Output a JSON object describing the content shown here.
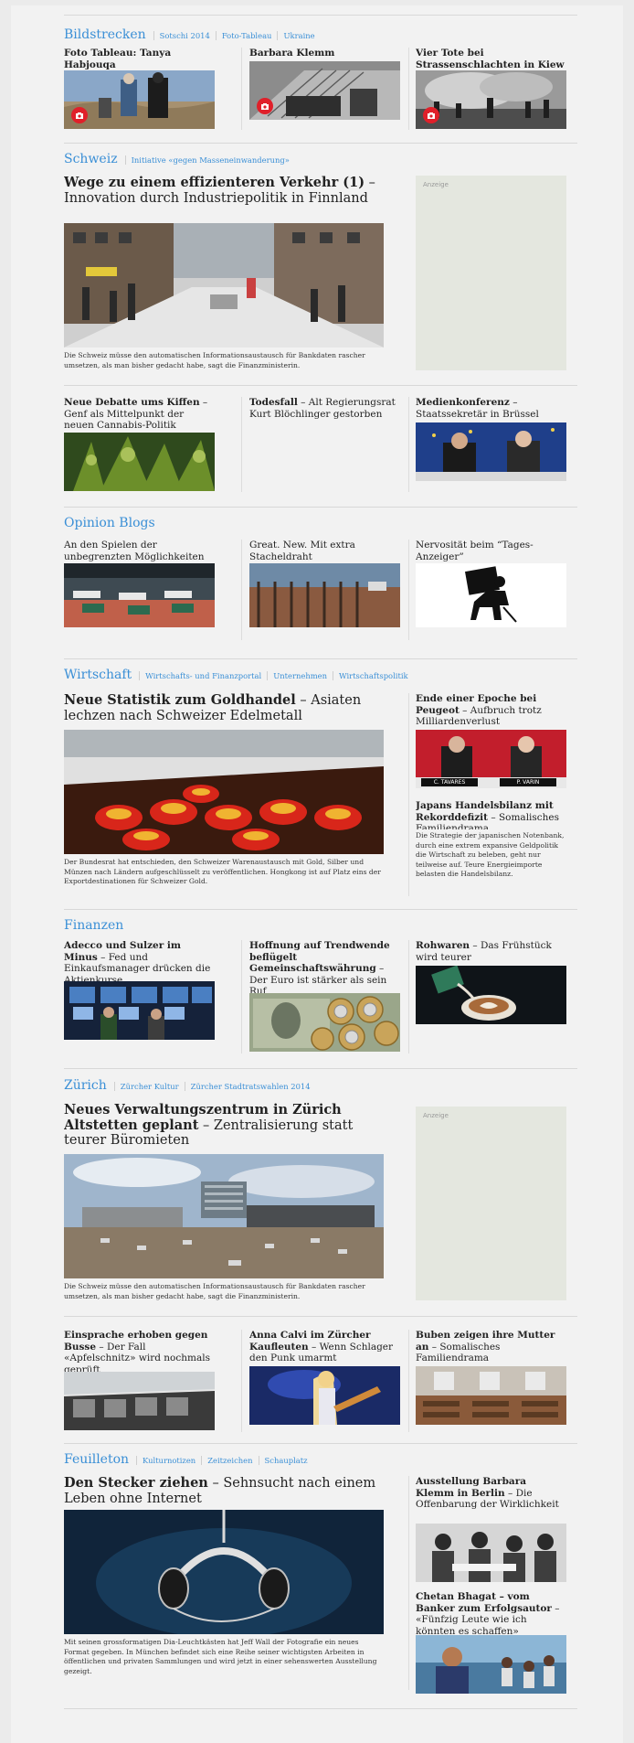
{
  "bildstrecken": {
    "title": "Bildstrecken",
    "links": [
      "Sotschi 2014",
      "Foto-Tableau",
      "Ukraine"
    ],
    "items": [
      "Foto Tableau: Tanya Habjouqa",
      "Barbara Klemm",
      "Vier Tote bei Strassenschlachten in Kiew"
    ]
  },
  "schweiz": {
    "title": "Schweiz",
    "links": [
      "Initiative «gegen Masseneinwanderung»"
    ],
    "main": {
      "head": "Wege zu einem effizienteren Verkehr (1)",
      "sub": " – Innovation durch Industriepolitik in Finnland",
      "lead": "Die Schweiz müsse den automatischen Informationsaustausch für Bankdaten rascher umsetzen, als man bisher gedacht habe, sagt die Finanzministerin."
    },
    "ad_label": "Anzeige",
    "teasers": [
      {
        "head": "Neue Debatte ums Kiffen",
        "sub": " – Genf als Mittelpunkt der neuen Cannabis-Politik"
      },
      {
        "head": "Todesfall",
        "sub": " – Alt Regierungsrat Kurt Blöchlinger gestorben"
      },
      {
        "head": "Medienkonferenz",
        "sub": " – Staatssekretär in Brüssel"
      }
    ]
  },
  "opinion": {
    "title": "Opinion Blogs",
    "items": [
      "An den Spielen der unbegrenzten Möglichkeiten",
      "Great. New. Mit extra Stacheldraht",
      "Nervosität beim “Tages-Anzeiger”"
    ]
  },
  "wirtschaft": {
    "title": "Wirtschaft",
    "links": [
      "Wirtschafts- und Finanzportal",
      "Unternehmen",
      "Wirtschaftspolitik"
    ],
    "main": {
      "head": "Neue Statistik zum Goldhandel",
      "sub": " – Asiaten lechzen nach Schweizer Edelmetall",
      "lead": "Der Bundesrat hat entschieden, den Schweizer Warenaustausch mit Gold, Silber und Münzen nach Ländern aufgeschlüsselt zu veröffentlichen. Hongkong ist auf Platz eins der Exportdestinationen für Schweizer Gold."
    },
    "side": [
      {
        "head": "Ende einer Epoche bei Peugeot",
        "sub": " – Aufbruch trotz Milliardenverlust",
        "labels": [
          "C. TAVARES",
          "P. VARIN"
        ]
      },
      {
        "head": "Japans Handelsbilanz mit Rekorddefizit",
        "sub": " – Somalisches Familiendrama",
        "lead": "Die Strategie der japanischen Notenbank, durch eine extrem expansive Geldpolitik die Wirtschaft zu beleben, geht nur teilweise auf. Teure Energieimporte belasten die Handelsbilanz."
      }
    ]
  },
  "finanzen": {
    "title": "Finanzen",
    "items": [
      {
        "head": "Adecco und Sulzer im Minus",
        "sub": " – Fed und Einkaufsmanager drücken die Aktienkurse"
      },
      {
        "head": "Hoffnung auf Trendwende beflügelt Gemeinschaftswährung",
        "sub": " – Der Euro ist stärker als sein Ruf"
      },
      {
        "head": "Rohwaren",
        "sub": " – Das Frühstück wird teurer"
      }
    ]
  },
  "zuerich": {
    "title": "Zürich",
    "links": [
      "Zürcher Kultur",
      "Zürcher Stadtratswahlen 2014"
    ],
    "main": {
      "head": "Neues Verwaltungszentrum in Zürich Altstetten geplant",
      "sub": " – Zentralisierung statt teurer Büromieten",
      "lead": "Die Schweiz müsse den automatischen Informationsaustausch für Bankdaten rascher umsetzen, als man bisher gedacht habe, sagt die Finanzministerin."
    },
    "ad_label": "Anzeige",
    "teasers": [
      {
        "head": "Einsprache erhoben gegen Busse",
        "sub": " – Der Fall «Apfelschnitz» wird nochmals geprüft"
      },
      {
        "head": "Anna Calvi im Zürcher Kaufleuten",
        "sub": " – Wenn Schlager den Punk umarmt"
      },
      {
        "head": "Buben zeigen ihre Mutter an",
        "sub": " – Somalisches Familiendrama"
      }
    ]
  },
  "feuilleton": {
    "title": "Feuilleton",
    "links": [
      "Kulturnotizen",
      "Zeitzeichen",
      "Schauplatz"
    ],
    "main": {
      "head": "Den Stecker ziehen",
      "sub": " – Sehnsucht nach einem Leben ohne Internet",
      "lead": "Mit seinen grossformatigen Dia-Leuchtkästen hat Jeff Wall der Fotografie ein neues Format gegeben. In München befindet sich eine Reihe seiner wichtigsten Arbeiten in öffentlichen und privaten Sammlungen und wird jetzt in einer sehenswerten Ausstellung gezeigt."
    },
    "side": [
      {
        "head": "Ausstellung Barbara Klemm in Berlin",
        "sub": " – Die Offenbarung der Wirklichkeit"
      },
      {
        "head": "Chetan Bhagat – vom Banker zum Erfolgsautor",
        "sub": " – «Fünfzig Leute wie ich könnten es schaffen»"
      }
    ]
  },
  "colors": {
    "accent": "#3a8fd6",
    "camera_badge": "#e0202a",
    "ad_bg": "#e4e7df"
  }
}
